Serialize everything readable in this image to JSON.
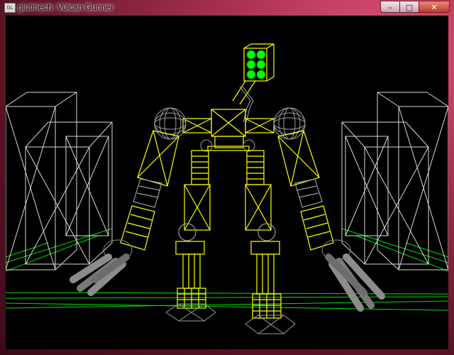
{
  "window": {
    "title": "glutmech: Vulcan Gunner",
    "icon_label": "GL",
    "controls": {
      "minimize_symbol": "–",
      "maximize_symbol": "□",
      "close_symbol": "✕"
    }
  },
  "scene": {
    "description_type": "OpenGL wireframe render",
    "colors": {
      "robot": "#ffff00",
      "head_lights": "#00ff00",
      "joints": "#8c8c8c",
      "buildings": "#ffffff",
      "grid": "#00e000",
      "background": "#000000"
    }
  }
}
